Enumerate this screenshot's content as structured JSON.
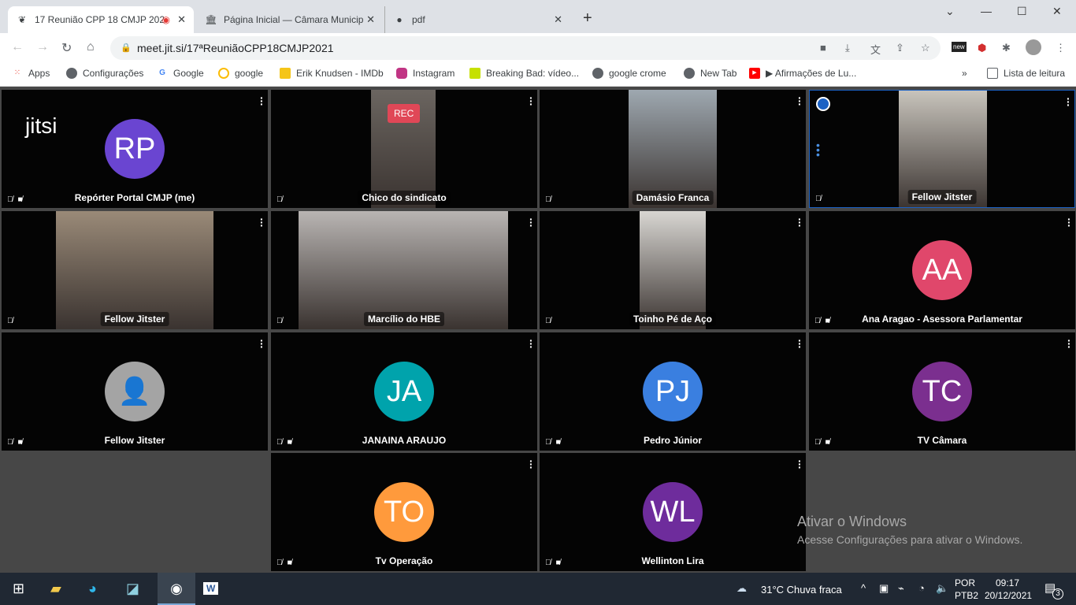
{
  "browser": {
    "tabs": [
      {
        "title": "17 Reunião CPP 18 CMJP 202",
        "icon": "jitsi-icon",
        "recording": true
      },
      {
        "title": "Página Inicial — Câmara Municip",
        "icon": "camara-icon"
      },
      {
        "title": "pdf",
        "icon": "globe-icon"
      }
    ],
    "url": "meet.jit.si/17ªReuniãoCPP18CMJP2021",
    "bookmarks": [
      {
        "label": "Apps",
        "color": "#ea4335"
      },
      {
        "label": "Configurações",
        "color": "#5f6368"
      },
      {
        "label": "Google",
        "color": "#4285f4"
      },
      {
        "label": "google",
        "color": "#fbbc05"
      },
      {
        "label": "Erik Knudsen - IMDb",
        "color": "#f5c518"
      },
      {
        "label": "Instagram",
        "color": "#c13584"
      },
      {
        "label": "Breaking Bad: vídeo...",
        "color": "#c6e000"
      },
      {
        "label": "google crome",
        "color": "#5f6368"
      },
      {
        "label": "New Tab",
        "color": "#5f6368"
      },
      {
        "label": "▶ Afirmações de Lu...",
        "color": "#ff0000"
      }
    ],
    "reading_list": "Lista de leitura"
  },
  "meeting": {
    "logo": "jitsi",
    "rec_label": "REC",
    "tiles": [
      {
        "name": "Repórter Portal CMJP (me)",
        "initials": "RP",
        "color": "#6a45d1",
        "video": false
      },
      {
        "name": "Chico do sindicato",
        "video": true,
        "vcolor": "#6b6560"
      },
      {
        "name": "Damásio Franca",
        "video": true,
        "vcolor": "#9ea8b0"
      },
      {
        "name": "Fellow Jitster",
        "video": true,
        "vcolor": "#c8c4bc",
        "active": true
      },
      {
        "name": "Fellow Jitster",
        "video": true,
        "vcolor": "#9a8a78"
      },
      {
        "name": "Marcílio do HBE",
        "video": true,
        "vcolor": "#b9b5b3"
      },
      {
        "name": "Toinho Pé de Aço",
        "video": true,
        "vcolor": "#d8d6d2"
      },
      {
        "name": "Ana Aragao - Asessora Parlamentar",
        "initials": "AA",
        "color": "#e0476b",
        "video": false
      },
      {
        "name": "Fellow Jitster",
        "initials": "",
        "color": "#a4a4a4",
        "video": false,
        "generic": true
      },
      {
        "name": "JANAINA ARAUJO",
        "initials": "JA",
        "color": "#00a3ac",
        "video": false
      },
      {
        "name": "Pedro Júnior",
        "initials": "PJ",
        "color": "#3a7fe0",
        "video": false
      },
      {
        "name": "TV Câmara",
        "initials": "TC",
        "color": "#7b2f8f",
        "video": false
      },
      {
        "name": "Tv Operação",
        "initials": "TO",
        "color": "#ff9a3c",
        "video": false
      },
      {
        "name": "Wellinton Lira",
        "initials": "WL",
        "color": "#6e2c9c",
        "video": false
      }
    ]
  },
  "watermark": {
    "title": "Ativar o Windows",
    "subtitle": "Acesse Configurações para ativar o Windows."
  },
  "taskbar": {
    "weather": "31°C  Chuva fraca",
    "lang1": "POR",
    "lang2": "PTB2",
    "time": "09:17",
    "date": "20/12/2021",
    "notifications": "3"
  }
}
